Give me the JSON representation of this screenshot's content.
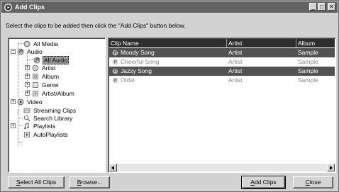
{
  "window": {
    "title": "Add Clips"
  },
  "instruction": "Select the clips to be added then click the \"Add Clips\" button below.",
  "tree": {
    "items": [
      {
        "label": "All Media",
        "icon": "media-icon"
      },
      {
        "label": "Audio",
        "icon": "audio-icon",
        "expander": "−"
      },
      {
        "label": "All Audio",
        "icon": "audio-icon",
        "selected": true
      },
      {
        "label": "Artist",
        "icon": "artist-icon",
        "expander": "+"
      },
      {
        "label": "Album",
        "icon": "album-icon",
        "expander": "+"
      },
      {
        "label": "Genre",
        "icon": "genre-icon",
        "expander": "+"
      },
      {
        "label": "Artist/Album",
        "icon": "artist-album-icon",
        "expander": "+"
      },
      {
        "label": "Video",
        "icon": "video-icon",
        "expander": "+"
      },
      {
        "label": "Streaming Clips",
        "icon": "streaming-icon"
      },
      {
        "label": "Search Library",
        "icon": "search-icon"
      },
      {
        "label": "Playlists",
        "icon": "playlists-icon",
        "expander": "+"
      },
      {
        "label": "AutoPlaylists",
        "icon": "autoplaylists-icon"
      }
    ]
  },
  "list": {
    "columns": [
      "Clip Name",
      "Artist",
      "Album"
    ],
    "rows": [
      {
        "name": "Moody Song",
        "artist": "Artist",
        "album": "Sample",
        "state": "selected"
      },
      {
        "name": "Cheerful Song",
        "artist": "Artist",
        "album": "Sample",
        "state": "normal"
      },
      {
        "name": "Jazzy Song",
        "artist": "Artist",
        "album": "Sample",
        "state": "selected"
      },
      {
        "name": "Oldie",
        "artist": "Artist",
        "album": "Sample",
        "state": "normal"
      }
    ]
  },
  "buttons": {
    "select_all": "Select All Clips",
    "browse": "Browse...",
    "add_clips": "Add Clips",
    "close": "Close"
  },
  "title_buttons": {
    "minimize": "_",
    "maximize": "□",
    "close": "✕"
  }
}
